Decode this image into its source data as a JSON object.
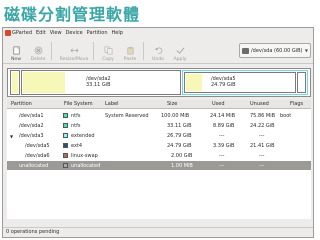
{
  "slide": {
    "title": "磁碟分割管理軟體"
  },
  "menubar": {
    "items": [
      {
        "label": "GParted"
      },
      {
        "label": "Edit"
      },
      {
        "label": "View"
      },
      {
        "label": "Device"
      },
      {
        "label": "Partition"
      },
      {
        "label": "Help"
      }
    ],
    "window_title": "/dev/sda - GParted"
  },
  "toolbar": {
    "new_label": "New",
    "delete_label": "Delete",
    "resize_label": "Resize/Move",
    "copy_label": "Copy",
    "paste_label": "Paste",
    "undo_label": "Undo",
    "apply_label": "Apply"
  },
  "device_selector": {
    "value": "/dev/sda  (60.00 GiB)"
  },
  "disk_map": {
    "segments": [
      {
        "name": "/dev/sda2",
        "size": "33.11 GiB"
      },
      {
        "name": "/dev/sda5",
        "size": "24.79 GiB"
      }
    ]
  },
  "table": {
    "headers": {
      "partition": "Partition",
      "filesystem": "File System",
      "label": "Label",
      "size": "Size",
      "used": "Used",
      "unused": "Unused",
      "flags": "Flags"
    },
    "rows": [
      {
        "partition": "/dev/sda1",
        "filesystem": "ntfs",
        "label": "System Reserved",
        "size": "100.00 MiB",
        "used": "24.14 MiB",
        "unused": "75.86 MiB",
        "flags": "boot",
        "color": "#42e5ac"
      },
      {
        "partition": "/dev/sda2",
        "filesystem": "ntfs",
        "label": "",
        "size": "33.11 GiB",
        "used": "8.89 GiB",
        "unused": "24.22 GiB",
        "flags": "",
        "color": "#42e5ac"
      },
      {
        "partition": "/dev/sda3",
        "filesystem": "extended",
        "label": "",
        "size": "26.79 GiB",
        "used": "---",
        "unused": "---",
        "flags": "",
        "color": "#7dfcfe"
      },
      {
        "partition": "/dev/sda5",
        "filesystem": "ext4",
        "label": "",
        "size": "24.79 GiB",
        "used": "3.39 GiB",
        "unused": "21.41 GiB",
        "flags": "",
        "color": "#314e78"
      },
      {
        "partition": "/dev/sda6",
        "filesystem": "linux-swap",
        "label": "",
        "size": "2.00 GiB",
        "used": "---",
        "unused": "---",
        "flags": "",
        "color": "#c1665a"
      },
      {
        "partition": "unallocated",
        "filesystem": "unallocated",
        "label": "",
        "size": "1.00 MiB",
        "used": "---",
        "unused": "---",
        "flags": "",
        "color": "#a9a9a9"
      }
    ]
  },
  "statusbar": {
    "text": "0 operations pending"
  }
}
